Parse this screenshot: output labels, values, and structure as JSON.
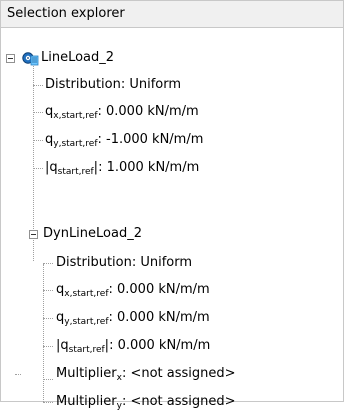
{
  "panel": {
    "title": "Selection explorer"
  },
  "tree": {
    "root": {
      "label": "LineLoad_2",
      "icon": "line-load-icon",
      "expanded": true,
      "props": {
        "distribution": "Distribution: Uniform",
        "qx": {
          "symbol": "q",
          "sub": "x,start,ref",
          "value": ": 0.000 kN/m/m"
        },
        "qy": {
          "symbol": "q",
          "sub": "y,start,ref",
          "value": ": -1.000 kN/m/m"
        },
        "qmag": {
          "open": "|q",
          "sub": "start,ref",
          "close": "|",
          "value": ": 1.000 kN/m/m"
        }
      }
    },
    "child": {
      "label": "DynLineLoad_2",
      "expanded": true,
      "props": {
        "distribution": "Distribution: Uniform",
        "qx": {
          "symbol": "q",
          "sub": "x,start,ref",
          "value": ": 0.000 kN/m/m"
        },
        "qy": {
          "symbol": "q",
          "sub": "y,start,ref",
          "value": ": 0.000 kN/m/m"
        },
        "qmag": {
          "open": "|q",
          "sub": "start,ref",
          "close": "|",
          "value": ": 0.000 kN/m/m"
        },
        "mult_x": {
          "label": "Multiplier",
          "sub": "x",
          "value": ": <not assigned>"
        },
        "mult_y": {
          "label": "Multiplier",
          "sub": "y",
          "value": ": <not assigned>"
        }
      }
    }
  }
}
